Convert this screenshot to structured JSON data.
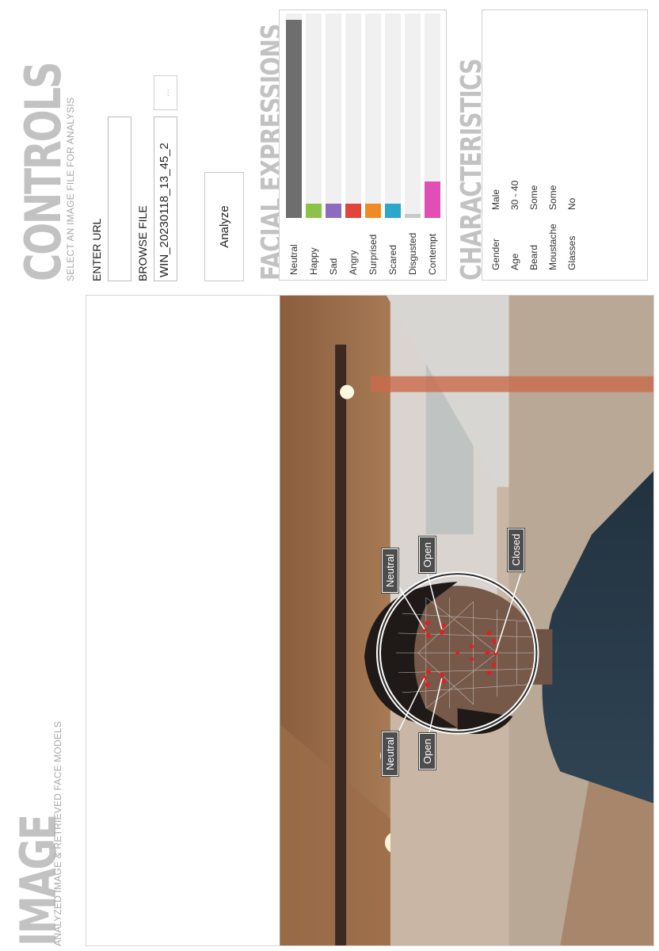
{
  "image_section": {
    "title": "IMAGE",
    "subtitle": "ANALYZED IMAGE & RETRIEVED FACE MODELS"
  },
  "controls": {
    "title": "CONTROLS",
    "subtitle": "SELECT AN IMAGE FILE FOR ANALYSIS",
    "enter_url_label": "ENTER URL",
    "url_value": "",
    "browse_file_label": "BROWSE FILE",
    "file_value": "WIN_20230118_13_45_2",
    "ellipsis_label": "...",
    "analyze_label": "Analyze"
  },
  "facial_expressions": {
    "title": "FACIAL EXPRESSIONS",
    "items": [
      {
        "label": "Neutral",
        "value": 0.97,
        "color": "#6e6e6e"
      },
      {
        "label": "Happy",
        "value": 0.07,
        "color": "#8bc34a"
      },
      {
        "label": "Sad",
        "value": 0.07,
        "color": "#8e6bbf"
      },
      {
        "label": "Angry",
        "value": 0.07,
        "color": "#e0443a"
      },
      {
        "label": "Surprised",
        "value": 0.07,
        "color": "#f08a24"
      },
      {
        "label": "Scared",
        "value": 0.07,
        "color": "#2aa7c9"
      },
      {
        "label": "Disgusted",
        "value": 0.02,
        "color": "#c8c8c8"
      },
      {
        "label": "Contempt",
        "value": 0.18,
        "color": "#e04fb5"
      }
    ]
  },
  "characteristics": {
    "title": "CHARACTERISTICS",
    "rows": [
      {
        "key": "Gender",
        "value": "Male"
      },
      {
        "key": "Age",
        "value": "30 - 40"
      },
      {
        "key": "Beard",
        "value": "Some"
      },
      {
        "key": "Moustache",
        "value": "Some"
      },
      {
        "key": "Glasses",
        "value": "No"
      }
    ]
  },
  "face_tags": {
    "left_eyebrow": "Neutral",
    "right_eyebrow": "Neutral",
    "left_eye": "Open",
    "right_eye": "Open",
    "mouth": "Closed"
  }
}
